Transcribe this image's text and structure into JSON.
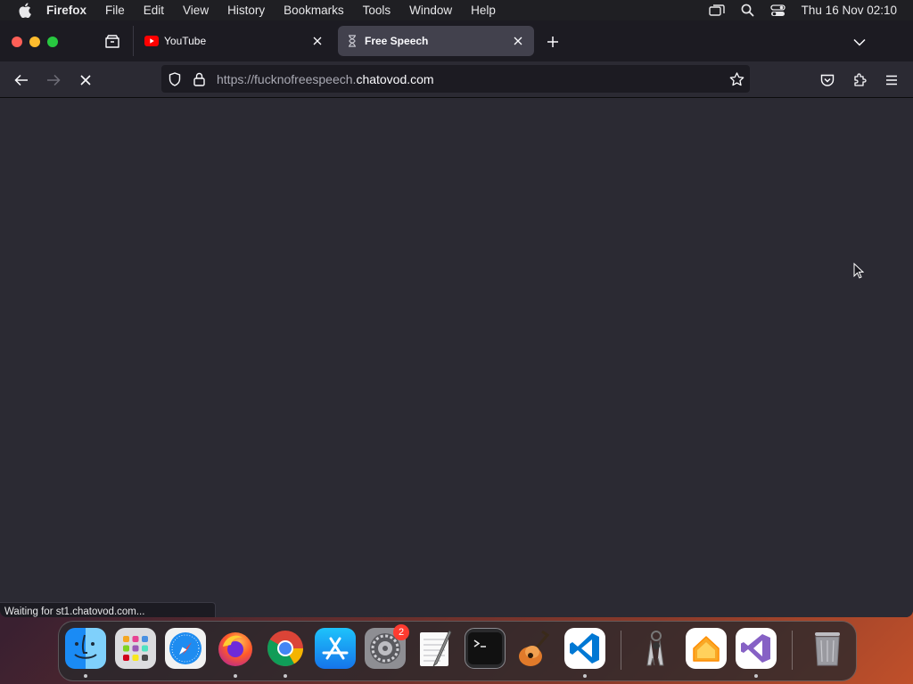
{
  "menubar": {
    "app_name": "Firefox",
    "items": [
      "File",
      "Edit",
      "View",
      "History",
      "Bookmarks",
      "Tools",
      "Window",
      "Help"
    ],
    "clock": "Thu 16 Nov  02:10"
  },
  "tabs": [
    {
      "title": "YouTube",
      "active": false,
      "icon": "youtube-icon"
    },
    {
      "title": "Free Speech",
      "active": true,
      "icon": "hourglass-icon"
    }
  ],
  "urlbar": {
    "url_prefix": "https://fucknofreespeech.",
    "url_host": "chatovod.com"
  },
  "status_text": "Waiting for st1.chatovod.com...",
  "dock": {
    "apps": [
      "finder-icon",
      "launchpad-icon",
      "safari-icon",
      "firefox-icon",
      "chrome-icon",
      "app-store-icon",
      "system-settings-icon",
      "textedit-icon",
      "terminal-icon",
      "garageband-icon",
      "vscode-icon",
      "keychain-icon",
      "home-icon",
      "visual-studio-icon",
      "trash-icon"
    ],
    "settings_badge": "2"
  },
  "colors": {
    "window_bg": "#2b2a33",
    "tabbar_bg": "#1c1b22",
    "active_tab": "#42414d",
    "close_red": "#fe5f57",
    "minimize_yellow": "#febc2e",
    "zoom_green": "#28c840"
  }
}
